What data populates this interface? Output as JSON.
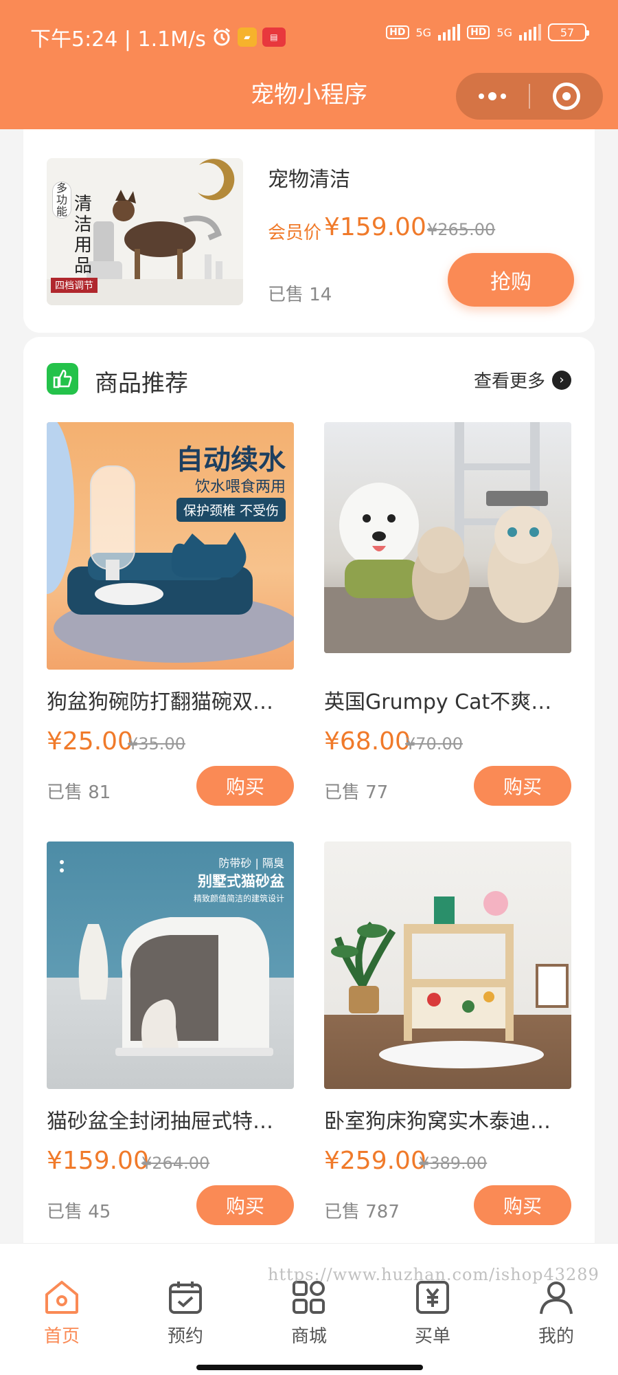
{
  "status_bar": {
    "time_speed": "下午5:24 | 1.1M/s",
    "network_a": "HD",
    "net_gen_a": "5G",
    "network_b": "HD",
    "net_gen_b": "5G",
    "battery": "57"
  },
  "header": {
    "title": "宠物小程序"
  },
  "top_product": {
    "name": "宠物清洁",
    "member_label": "会员价",
    "price": "¥159.00",
    "original_price": "¥265.00",
    "sold": "已售 14",
    "buy_label": "抢购",
    "image_text": {
      "side_badge": "多功能",
      "main_text": "清洁用品",
      "bottom_tag": "四档调节"
    }
  },
  "recommend": {
    "title": "商品推荐",
    "more_label": "查看更多",
    "items": [
      {
        "title": "狗盆狗碗防打翻猫碗双…",
        "price": "¥25.00",
        "original_price": "¥35.00",
        "sold": "已售 81",
        "buy_label": "购买",
        "image_text": {
          "headline": "自动续水",
          "sub": "饮水喂食两用",
          "banner": "保护颈椎 不受伤"
        }
      },
      {
        "title": "英国Grumpy Cat不爽…",
        "price": "¥68.00",
        "original_price": "¥70.00",
        "sold": "已售 77",
        "buy_label": "购买"
      },
      {
        "title": "猫砂盆全封闭抽屉式特…",
        "price": "¥159.00",
        "original_price": "¥264.00",
        "sold": "已售 45",
        "buy_label": "购买",
        "image_text": {
          "tagline": "防带砂 | 隔臭",
          "headline": "别墅式猫砂盆",
          "sub": "精致颜值简洁的建筑设计"
        }
      },
      {
        "title": "卧室狗床狗窝实木泰迪…",
        "price": "¥259.00",
        "original_price": "¥389.00",
        "sold": "已售 787",
        "buy_label": "购买"
      }
    ]
  },
  "tabbar": {
    "items": [
      {
        "label": "首页",
        "icon": "home-icon",
        "active": true
      },
      {
        "label": "预约",
        "icon": "calendar-icon",
        "active": false
      },
      {
        "label": "商城",
        "icon": "grid-icon",
        "active": false
      },
      {
        "label": "买单",
        "icon": "bill-icon",
        "active": false
      },
      {
        "label": "我的",
        "icon": "user-icon",
        "active": false
      }
    ]
  },
  "watermark": "https://www.huzhan.com/ishop43289",
  "colors": {
    "brand": "#fa8a55",
    "price": "#f07a2a",
    "green": "#24c24a"
  }
}
